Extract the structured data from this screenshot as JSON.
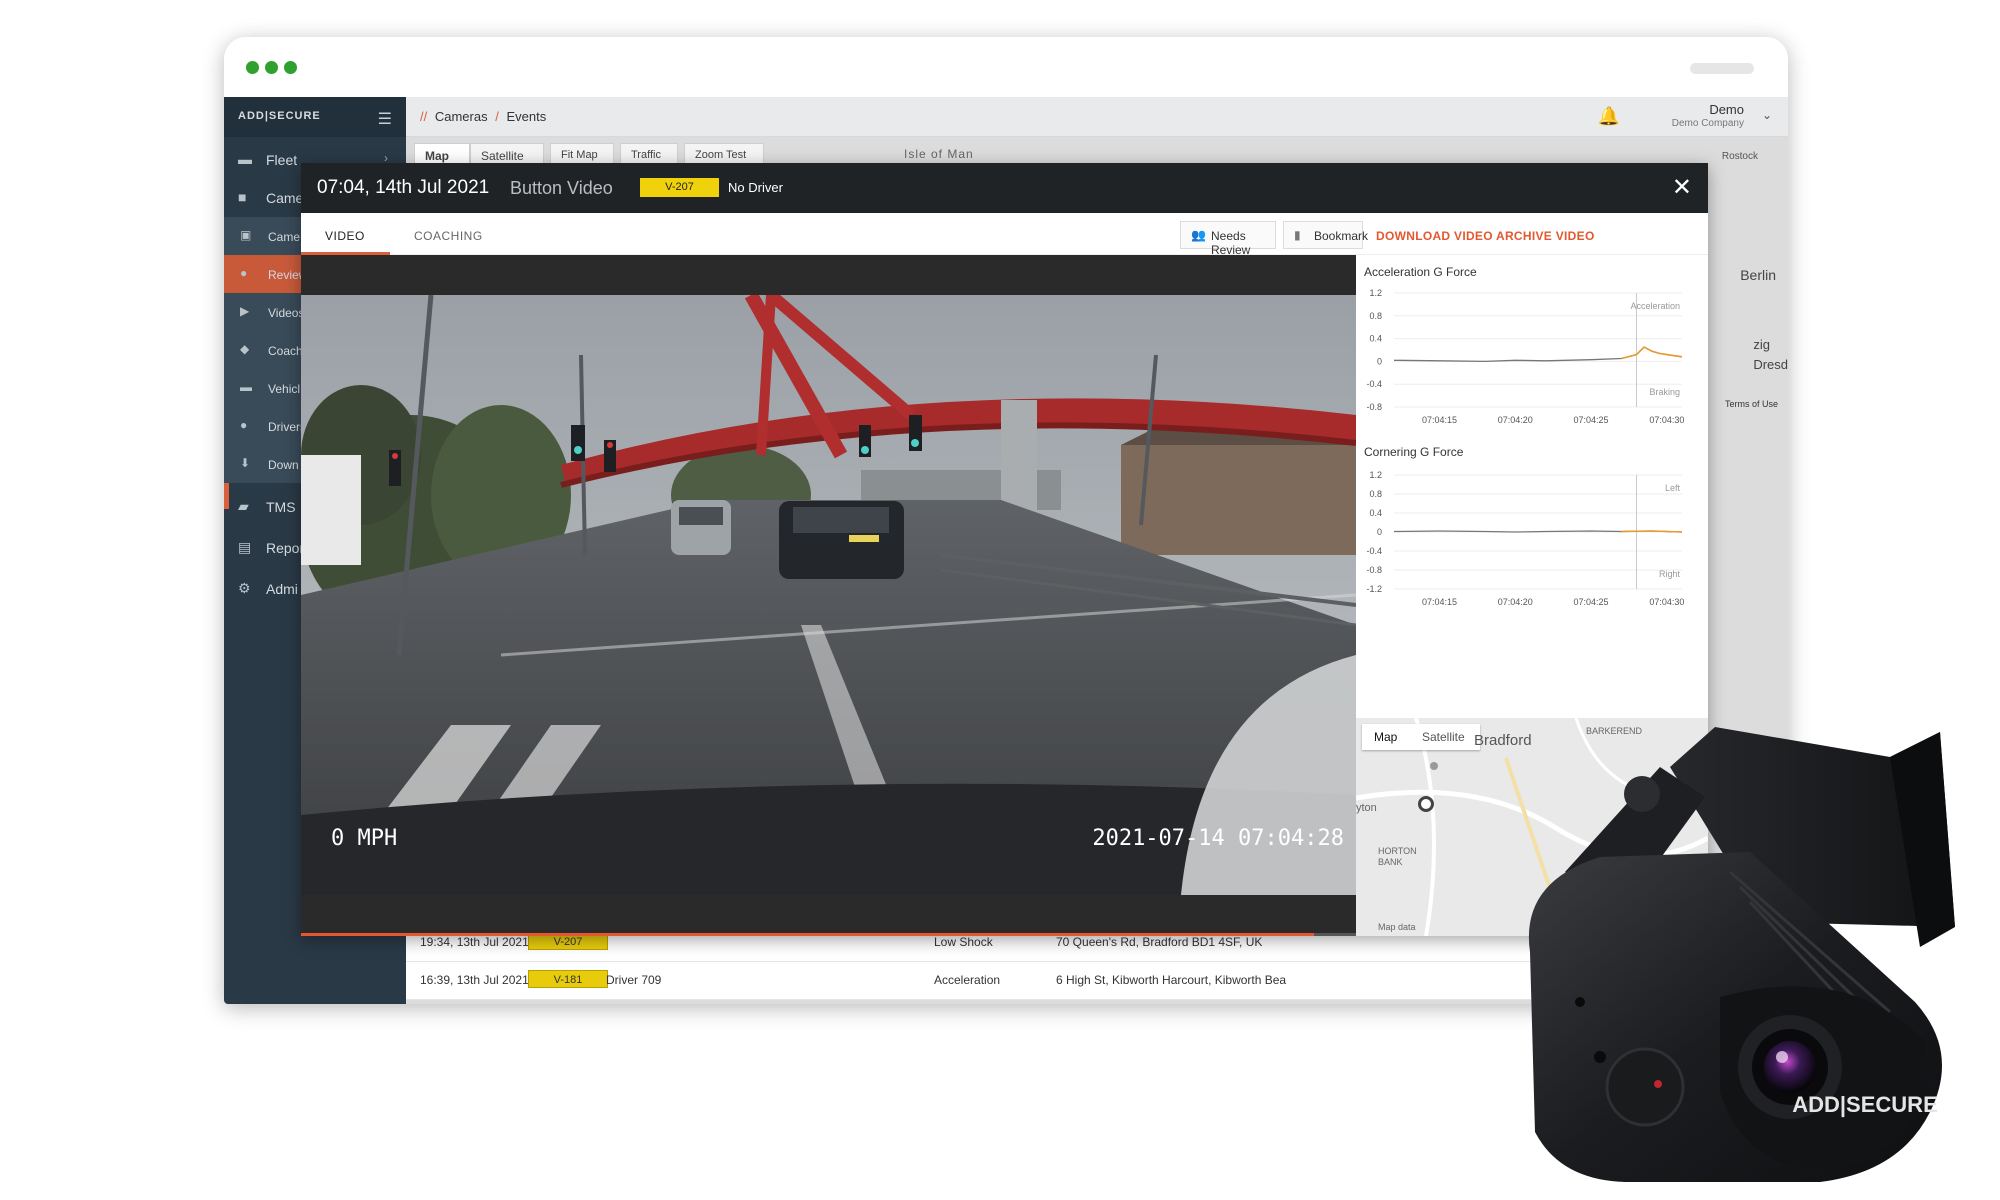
{
  "browser": {
    "dots": [
      "green",
      "green",
      "green"
    ]
  },
  "sidebar": {
    "brand": "ADD|SECURE",
    "items": [
      {
        "label": "Fleet",
        "icon": "truck-icon"
      },
      {
        "label": "Came",
        "icon": "camera-icon"
      },
      {
        "label": "Came",
        "icon": "camera-sub-icon"
      },
      {
        "label": "Review",
        "icon": "review-icon"
      },
      {
        "label": "Videos",
        "icon": "video-icon"
      },
      {
        "label": "Coach",
        "icon": "coach-icon"
      },
      {
        "label": "Vehicl",
        "icon": "vehicle-icon"
      },
      {
        "label": "Drivers",
        "icon": "driver-icon"
      },
      {
        "label": "Down",
        "icon": "download-icon"
      },
      {
        "label": "TMS",
        "icon": "briefcase-icon"
      },
      {
        "label": "Repor",
        "icon": "report-icon"
      },
      {
        "label": "Admi",
        "icon": "gear-icon"
      }
    ]
  },
  "header": {
    "breadcrumb": [
      "Cameras",
      "Events"
    ],
    "user": {
      "name": "Demo",
      "company": "Demo Company"
    }
  },
  "map": {
    "tabs": [
      "Map",
      "Satellite",
      "Fit Map",
      "Traffic",
      "Zoom Test"
    ],
    "labels": {
      "island": "Isle of Man",
      "berlin": "Berlin",
      "rostock": "Rostock",
      "dresd": "Dresd",
      "zig": "zig",
      "terms": "Terms of Use"
    }
  },
  "events_table": {
    "rows": [
      {
        "time": "19:34, 13th Jul 2021",
        "vehicle": "V-207",
        "driver": "",
        "event": "Low Shock",
        "address": "70 Queen's Rd, Bradford BD1 4SF, UK"
      },
      {
        "time": "16:39, 13th Jul 2021",
        "vehicle": "V-181",
        "driver": "Driver 709",
        "event": "Acceleration",
        "address": "6 High St, Kibworth Harcourt, Kibworth Bea"
      }
    ]
  },
  "modal": {
    "time": "07:04, 14th Jul 2021",
    "type": "Button Video",
    "vehicle": "V-207",
    "driver": "No Driver",
    "tabs": [
      "VIDEO",
      "COACHING"
    ],
    "actions": {
      "needs_review": "Needs Review",
      "bookmark": "Bookmark",
      "download": "DOWNLOAD VIDEO",
      "archive": "ARCHIVE VIDEO"
    },
    "video": {
      "speed": "0 MPH",
      "timestamp": "2021-07-14 07:04:28",
      "progress": 0.96
    }
  },
  "charts": {
    "acceleration": {
      "title": "Acceleration G Force",
      "y_ticks": [
        "1.2",
        "0.8",
        "0.4",
        "0",
        "-0.4",
        "-0.8"
      ],
      "x_ticks": [
        "07:04:15",
        "07:04:20",
        "07:04:25",
        "07:04:30"
      ],
      "top_label": "Acceleration",
      "bottom_label": "Braking"
    },
    "cornering": {
      "title": "Cornering G Force",
      "y_ticks": [
        "1.2",
        "0.8",
        "0.4",
        "0",
        "-0.4",
        "-0.8",
        "-1.2"
      ],
      "x_ticks": [
        "07:04:15",
        "07:04:20",
        "07:04:25",
        "07:04:30"
      ],
      "top_label": "Left",
      "bottom_label": "Right"
    }
  },
  "chart_data": [
    {
      "type": "line",
      "title": "Acceleration G Force",
      "x": [
        "07:04:12",
        "07:04:15",
        "07:04:18",
        "07:04:20",
        "07:04:22",
        "07:04:25",
        "07:04:27",
        "07:04:28",
        "07:04:28.5",
        "07:04:29",
        "07:04:29.5",
        "07:04:30",
        "07:04:31"
      ],
      "series": [
        {
          "values": [
            0.02,
            0.01,
            0.0,
            0.02,
            0.01,
            0.03,
            0.05,
            0.12,
            0.25,
            0.18,
            0.14,
            0.12,
            0.08
          ]
        }
      ],
      "ylim": [
        -0.8,
        1.2
      ]
    },
    {
      "type": "line",
      "title": "Cornering G Force",
      "x": [
        "07:04:12",
        "07:04:15",
        "07:04:18",
        "07:04:20",
        "07:04:22",
        "07:04:25",
        "07:04:27",
        "07:04:29",
        "07:04:31"
      ],
      "series": [
        {
          "values": [
            0.01,
            0.02,
            0.01,
            0.0,
            0.01,
            0.02,
            0.01,
            0.02,
            0.0
          ]
        }
      ],
      "ylim": [
        -1.2,
        1.2
      ]
    }
  ],
  "mini_map": {
    "tabs": [
      "Map",
      "Satellite"
    ],
    "labels": {
      "bradford": "Bradford",
      "barkerend": "BARKEREND",
      "horton": "HORTON",
      "bank": "BANK",
      "yton": "yton",
      "map_data": "Map data"
    }
  },
  "device": {
    "brand": "ADD|SECURE"
  },
  "colors": {
    "accent": "#e3582e",
    "sidebar": "#2a3946",
    "badge": "#f0d20c",
    "chart_line": "#e89a2c"
  }
}
